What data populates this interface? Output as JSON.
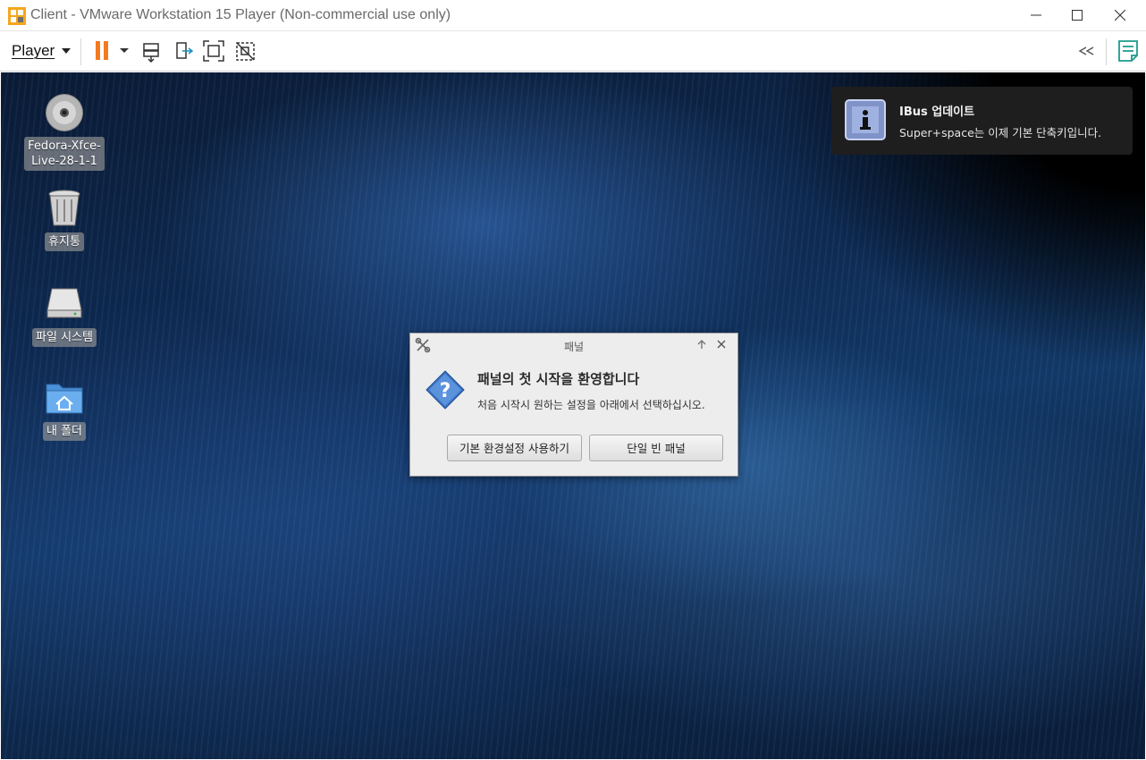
{
  "window": {
    "title": "Client - VMware Workstation 15 Player (Non-commercial use only)"
  },
  "toolbar": {
    "player_label": "Player",
    "accent": "#f47a20"
  },
  "desktop": {
    "icons": [
      {
        "label": "Fedora-Xfce-\nLive-28-1-1",
        "icon": "cd-disc-icon"
      },
      {
        "label": "휴지통",
        "icon": "trash-icon"
      },
      {
        "label": "파일 시스템",
        "icon": "hard-drive-icon"
      },
      {
        "label": "내 폴더",
        "icon": "home-folder-icon"
      }
    ]
  },
  "notification": {
    "title": "IBus 업데이트",
    "body": "Super+space는 이제 기본 단축키입니다."
  },
  "dialog": {
    "title": "패널",
    "heading": "패널의 첫 시작을 환영합니다",
    "message": "처음 시작시 원하는 설정을 아래에서 선택하십시오.",
    "buttons": {
      "default_config": "기본 환경설정 사용하기",
      "one_empty_panel": "단일 빈 패널"
    }
  }
}
